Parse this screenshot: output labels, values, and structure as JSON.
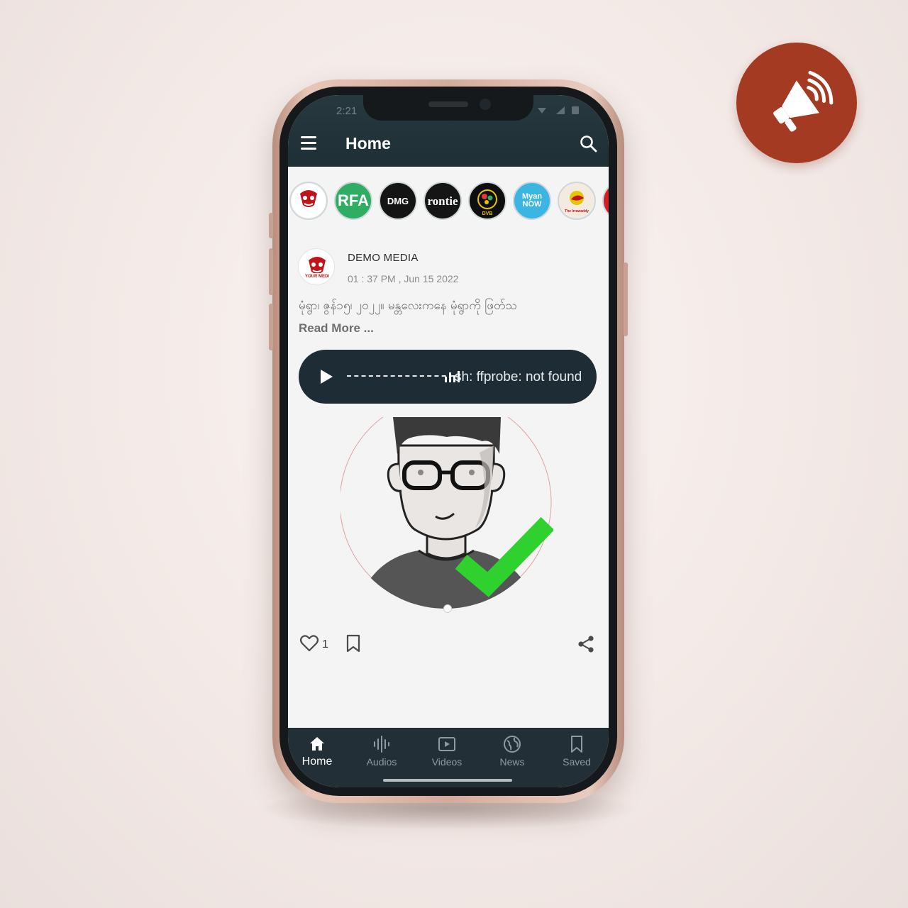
{
  "app": {
    "title": "Home",
    "status_time": "2:21"
  },
  "stories": [
    {
      "name": "YOUR MEDIA",
      "text": "YOUR MEDI",
      "bg": "#ffffff",
      "fg": "#c0141c"
    },
    {
      "name": "RFA",
      "text": "RFA",
      "bg": "#2fae63",
      "fg": "#ffffff"
    },
    {
      "name": "DMG",
      "text": "DMG",
      "bg": "#141414",
      "fg": "#ffffff"
    },
    {
      "name": "Frontier",
      "text": "rontie",
      "bg": "#151515",
      "fg": "#ffffff"
    },
    {
      "name": "DVB",
      "text": "DVB",
      "bg": "#0e0e0e",
      "fg": "#e8c300"
    },
    {
      "name": "Myanmar Now",
      "text": "Myan NOW",
      "bg": "#3bb6e3",
      "fg": "#ffffff"
    },
    {
      "name": "The Irrawaddy",
      "text": "The Irrawaddy",
      "bg": "#f3ebe0",
      "fg": "#c0141c"
    },
    {
      "name": "more",
      "text": "",
      "bg": "#d01f26",
      "fg": "#ffffff"
    }
  ],
  "post": {
    "author": "DEMO MEDIA",
    "time": "01 : 37 PM , Jun 15 2022",
    "body": "မုံရွာ၊ ဇွန်၁၅၊ ၂၀၂၂။ မန္တလေးကနေ မုံရွာကို ဖြတ်သ",
    "read_more": "Read More ...",
    "audio_status": "sh: ffprobe: not found",
    "likes": "1"
  },
  "nav": {
    "items": [
      {
        "label": "Home",
        "icon": "home-icon"
      },
      {
        "label": "Audios",
        "icon": "audio-wave-icon"
      },
      {
        "label": "Videos",
        "icon": "video-play-icon"
      },
      {
        "label": "News",
        "icon": "globe-icon"
      },
      {
        "label": "Saved",
        "icon": "bookmark-icon"
      }
    ],
    "active": "Home"
  },
  "colors": {
    "appbar": "#1f2f36",
    "badge": "#a33a21",
    "check": "#2fd12f"
  }
}
